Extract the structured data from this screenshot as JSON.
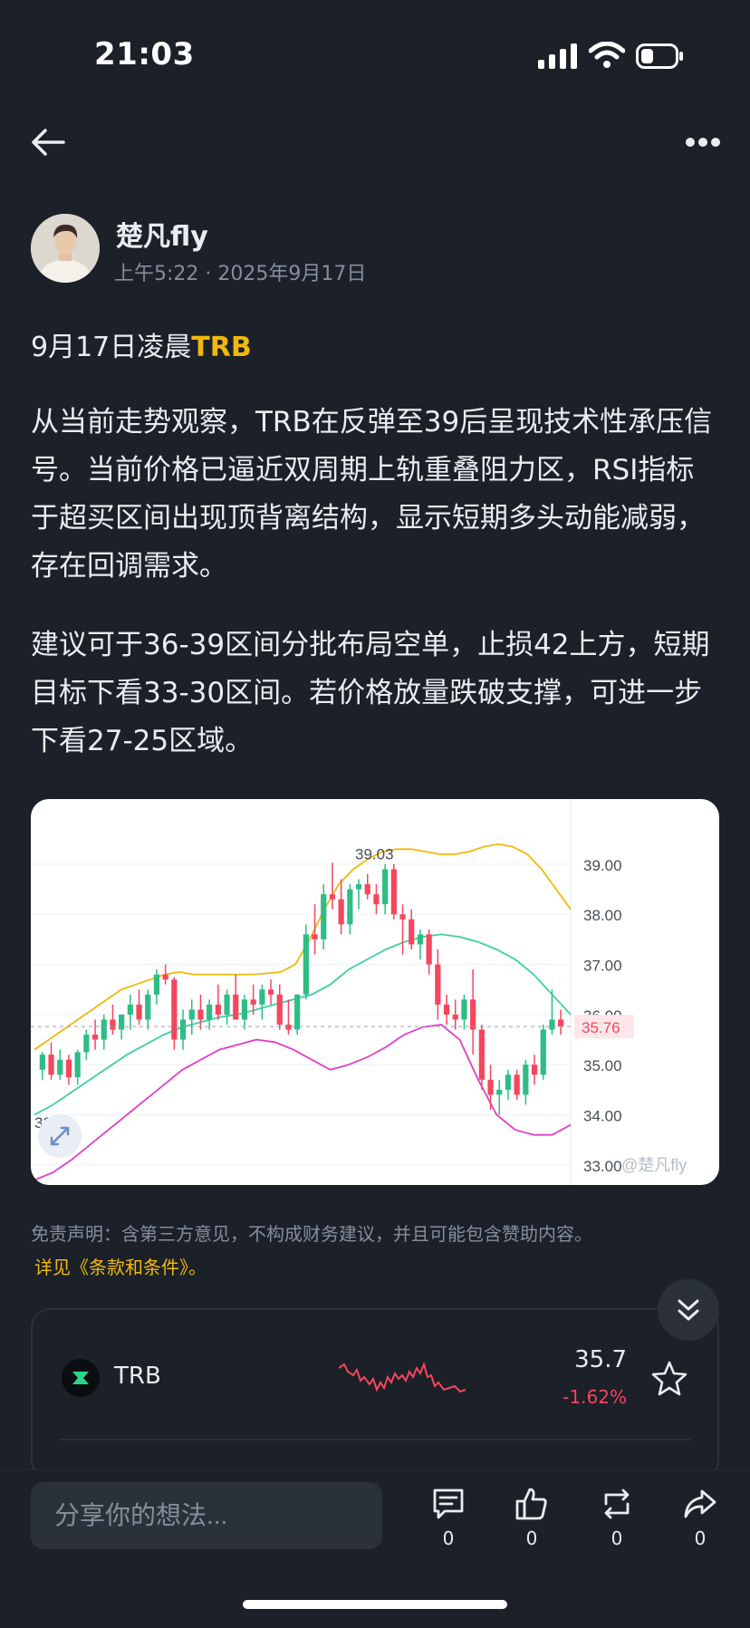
{
  "status": {
    "time": "21:03"
  },
  "author": {
    "name": "楚凡fly",
    "time": "上午5:22",
    "date": "2025年9月17日"
  },
  "post": {
    "title_prefix": "9月17日凌晨",
    "title_ticker": "TRB",
    "paragraphs": [
      "从当前走势观察，TRB在反弹至39后呈现技术性承压信号。当前价格已逼近双周期上轨重叠阻力区，RSI指标于超买区间出现顶背离结构，显示短期多头动能减弱，存在回调需求。",
      "建议可于36-39区间分批布局空单，止损42上方，短期目标下看33-30区间。若价格放量跌破支撑，可进一步下看27-25区域。"
    ]
  },
  "chart_data": {
    "type": "candlestick",
    "y_ticks": [
      "39.00",
      "38.00",
      "37.00",
      "36.00",
      "35.00",
      "34.00",
      "33.00"
    ],
    "ylim": [
      32.6,
      40.3
    ],
    "current_price_label": "35.76",
    "current_price": 35.76,
    "high_label": "39.03",
    "high": 39.03,
    "low_label": "33.85",
    "low": 33.85,
    "watermark": "@楚凡fly",
    "colors": {
      "up": "#2ebd85",
      "down": "#f6465d",
      "upper_band": "#f0b90b",
      "middle_band": "#3fcfa4",
      "lower_band": "#e040c8"
    },
    "candles": [
      [
        34.9,
        35.25,
        34.7,
        35.2
      ],
      [
        35.2,
        35.45,
        34.7,
        34.8
      ],
      [
        34.8,
        35.3,
        34.7,
        35.1
      ],
      [
        35.1,
        35.2,
        34.6,
        34.75
      ],
      [
        34.75,
        35.3,
        34.6,
        35.25
      ],
      [
        35.25,
        35.7,
        35.1,
        35.6
      ],
      [
        35.6,
        35.9,
        35.3,
        35.5
      ],
      [
        35.5,
        36.0,
        35.3,
        35.9
      ],
      [
        35.9,
        36.2,
        35.6,
        35.7
      ],
      [
        35.7,
        36.0,
        35.5,
        36.0
      ],
      [
        36.0,
        36.4,
        35.7,
        36.2
      ],
      [
        36.2,
        36.5,
        35.8,
        35.9
      ],
      [
        35.9,
        36.5,
        35.7,
        36.4
      ],
      [
        36.4,
        36.9,
        36.2,
        36.8
      ],
      [
        36.8,
        37.0,
        36.6,
        36.7
      ],
      [
        36.7,
        36.75,
        35.3,
        35.5
      ],
      [
        35.5,
        36.1,
        35.3,
        35.9
      ],
      [
        35.9,
        36.3,
        35.6,
        36.1
      ],
      [
        36.1,
        36.4,
        35.7,
        35.9
      ],
      [
        35.9,
        36.3,
        35.7,
        36.2
      ],
      [
        36.2,
        36.6,
        35.9,
        36.0
      ],
      [
        36.0,
        36.5,
        35.8,
        36.4
      ],
      [
        36.4,
        36.8,
        36.1,
        35.9
      ],
      [
        35.9,
        36.4,
        35.7,
        36.3
      ],
      [
        36.3,
        36.6,
        36.0,
        36.2
      ],
      [
        36.2,
        36.6,
        35.9,
        36.5
      ],
      [
        36.5,
        36.7,
        36.2,
        36.4
      ],
      [
        36.4,
        36.6,
        35.7,
        35.8
      ],
      [
        35.8,
        36.3,
        35.6,
        35.7
      ],
      [
        35.7,
        36.4,
        35.6,
        36.4
      ],
      [
        36.4,
        37.8,
        36.3,
        37.6
      ],
      [
        37.6,
        38.2,
        37.2,
        37.5
      ],
      [
        37.5,
        38.6,
        37.3,
        38.4
      ],
      [
        38.4,
        39.03,
        38.1,
        38.3
      ],
      [
        38.3,
        38.7,
        37.6,
        37.8
      ],
      [
        37.8,
        38.6,
        37.6,
        38.5
      ],
      [
        38.5,
        38.7,
        38.1,
        38.6
      ],
      [
        38.6,
        38.8,
        38.3,
        38.4
      ],
      [
        38.4,
        38.6,
        38.0,
        38.2
      ],
      [
        38.2,
        39.0,
        38.0,
        38.9
      ],
      [
        38.9,
        39.0,
        37.9,
        38.0
      ],
      [
        38.0,
        38.2,
        37.2,
        37.9
      ],
      [
        37.9,
        38.1,
        37.3,
        37.4
      ],
      [
        37.4,
        37.7,
        37.1,
        37.6
      ],
      [
        37.6,
        37.7,
        36.8,
        37.0
      ],
      [
        37.0,
        37.3,
        35.9,
        36.2
      ],
      [
        36.2,
        36.4,
        35.8,
        36.0
      ],
      [
        36.0,
        36.3,
        35.7,
        35.9
      ],
      [
        35.9,
        36.4,
        35.7,
        36.3
      ],
      [
        36.3,
        36.9,
        35.2,
        35.7
      ],
      [
        35.7,
        35.8,
        34.5,
        34.7
      ],
      [
        34.7,
        35.0,
        34.1,
        34.4
      ],
      [
        34.4,
        34.7,
        34.0,
        34.5
      ],
      [
        34.5,
        34.9,
        34.3,
        34.8
      ],
      [
        34.8,
        34.9,
        34.3,
        34.4
      ],
      [
        34.4,
        35.1,
        34.2,
        35.0
      ],
      [
        35.0,
        35.2,
        34.6,
        34.8
      ],
      [
        34.8,
        35.8,
        34.7,
        35.7
      ],
      [
        35.7,
        36.5,
        35.6,
        35.9
      ],
      [
        35.9,
        36.1,
        35.6,
        35.76
      ]
    ],
    "upper_band": [
      35.3,
      35.5,
      35.7,
      35.9,
      36.1,
      36.3,
      36.5,
      36.6,
      36.7,
      36.8,
      36.85,
      36.8,
      36.8,
      36.8,
      36.8,
      36.8,
      36.82,
      36.85,
      37.0,
      37.5,
      38.1,
      38.6,
      38.9,
      39.1,
      39.25,
      39.3,
      39.3,
      39.25,
      39.2,
      39.2,
      39.25,
      39.35,
      39.4,
      39.35,
      39.2,
      38.9,
      38.5,
      38.1
    ],
    "middle_band": [
      34.0,
      34.2,
      34.45,
      34.7,
      34.95,
      35.2,
      35.4,
      35.6,
      35.75,
      35.85,
      35.95,
      36.0,
      36.1,
      36.2,
      36.3,
      36.4,
      36.6,
      36.9,
      37.1,
      37.3,
      37.45,
      37.55,
      37.6,
      37.55,
      37.45,
      37.3,
      37.1,
      36.8,
      36.4,
      36.0
    ],
    "lower_band": [
      32.7,
      32.85,
      33.1,
      33.4,
      33.7,
      34.0,
      34.3,
      34.6,
      34.9,
      35.1,
      35.3,
      35.4,
      35.5,
      35.45,
      35.3,
      35.1,
      34.9,
      35.0,
      35.15,
      35.35,
      35.6,
      35.75,
      35.8,
      35.5,
      34.7,
      34.0,
      33.7,
      33.6,
      33.6,
      33.8
    ]
  },
  "disclaimer": {
    "text": "免责声明：含第三方意见，不构成财务建议，并且可能包含赞助内容。",
    "link": "详见《条款和条件》。"
  },
  "coin": {
    "symbol": "TRB",
    "price": "35.7",
    "change": "-1.62%"
  },
  "comment": {
    "placeholder": "分享你的想法..."
  },
  "actions": {
    "comment_count": "0",
    "like_count": "0",
    "repost_count": "0",
    "share_count": "0"
  },
  "icons": [
    "back-arrow-icon",
    "more-icon",
    "expand-icon",
    "star-icon",
    "chevrons-down-icon",
    "comment-icon",
    "like-icon",
    "repost-icon",
    "share-icon"
  ]
}
